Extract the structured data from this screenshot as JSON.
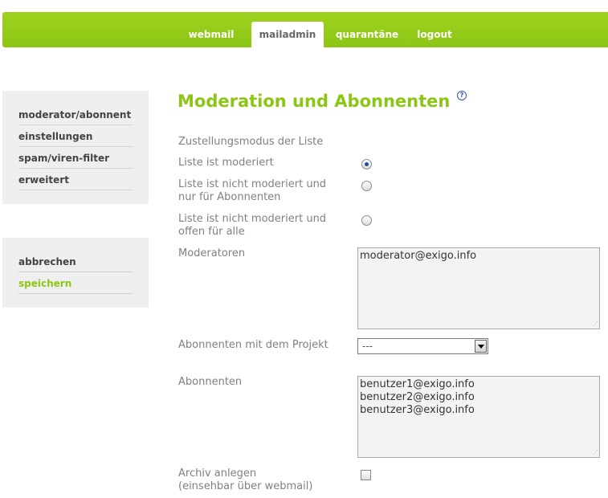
{
  "nav": {
    "items": [
      {
        "label": "webmail",
        "active": false
      },
      {
        "label": "mailadmin",
        "active": true
      },
      {
        "label": "quarantäne",
        "active": false
      },
      {
        "label": "logout",
        "active": false
      }
    ]
  },
  "sidebar": {
    "menu": [
      {
        "label": "moderator/abonnent"
      },
      {
        "label": "einstellungen"
      },
      {
        "label": "spam/viren-filter"
      },
      {
        "label": "erweitert"
      }
    ],
    "actions": {
      "cancel": "abbrechen",
      "save": "speichern"
    }
  },
  "main": {
    "title": "Moderation und Abonnenten",
    "help_symbol": "?",
    "delivery_mode_label": "Zustellungsmodus der Liste",
    "radio_options": [
      {
        "label": "Liste ist moderiert",
        "checked": true
      },
      {
        "label": "Liste ist nicht moderiert und nur für Abonnenten",
        "checked": false
      },
      {
        "label": "Liste ist nicht moderiert und offen für alle",
        "checked": false
      }
    ],
    "moderators_label": "Moderatoren",
    "moderators_value": "moderator@exigo.info",
    "project_subscribers_label": "Abonnenten mit dem Projekt",
    "project_select_value": "---",
    "subscribers_label": "Abonnenten",
    "subscribers_value": "benutzer1@exigo.info\nbenutzer2@exigo.info\nbenutzer3@exigo.info",
    "archive_label_line1": "Archiv anlegen",
    "archive_label_line2": "(einsehbar über webmail)",
    "archive_checked": false
  },
  "colors": {
    "brand_green": "#8cc615",
    "radio_dot": "#1d4f8f"
  }
}
